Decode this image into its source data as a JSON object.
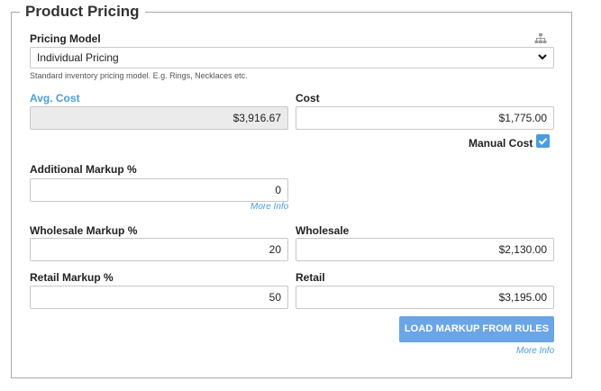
{
  "section": {
    "title": "Product Pricing"
  },
  "pricing_model": {
    "label": "Pricing Model",
    "selected": "Individual Pricing",
    "help_text": "Standard inventory pricing model. E.g. Rings, Necklaces etc.",
    "icon": "hierarchy-icon"
  },
  "avg_cost": {
    "label": "Avg. Cost",
    "value": "$3,916.67"
  },
  "cost": {
    "label": "Cost",
    "value": "$1,775.00"
  },
  "manual_cost": {
    "label": "Manual Cost",
    "checked": true
  },
  "additional_markup": {
    "label": "Additional Markup %",
    "value": "0",
    "more_info": "More Info"
  },
  "wholesale_markup": {
    "label": "Wholesale Markup %",
    "value": "20"
  },
  "wholesale": {
    "label": "Wholesale",
    "value": "$2,130.00"
  },
  "retail_markup": {
    "label": "Retail Markup %",
    "value": "50"
  },
  "retail": {
    "label": "Retail",
    "value": "$3,195.00"
  },
  "load_button": {
    "label": "LOAD MARKUP FROM RULES",
    "more_info": "More Info"
  },
  "colors": {
    "accent": "#4a9ee0",
    "button": "#6aa5e8",
    "readonly_bg": "#ebebeb"
  }
}
